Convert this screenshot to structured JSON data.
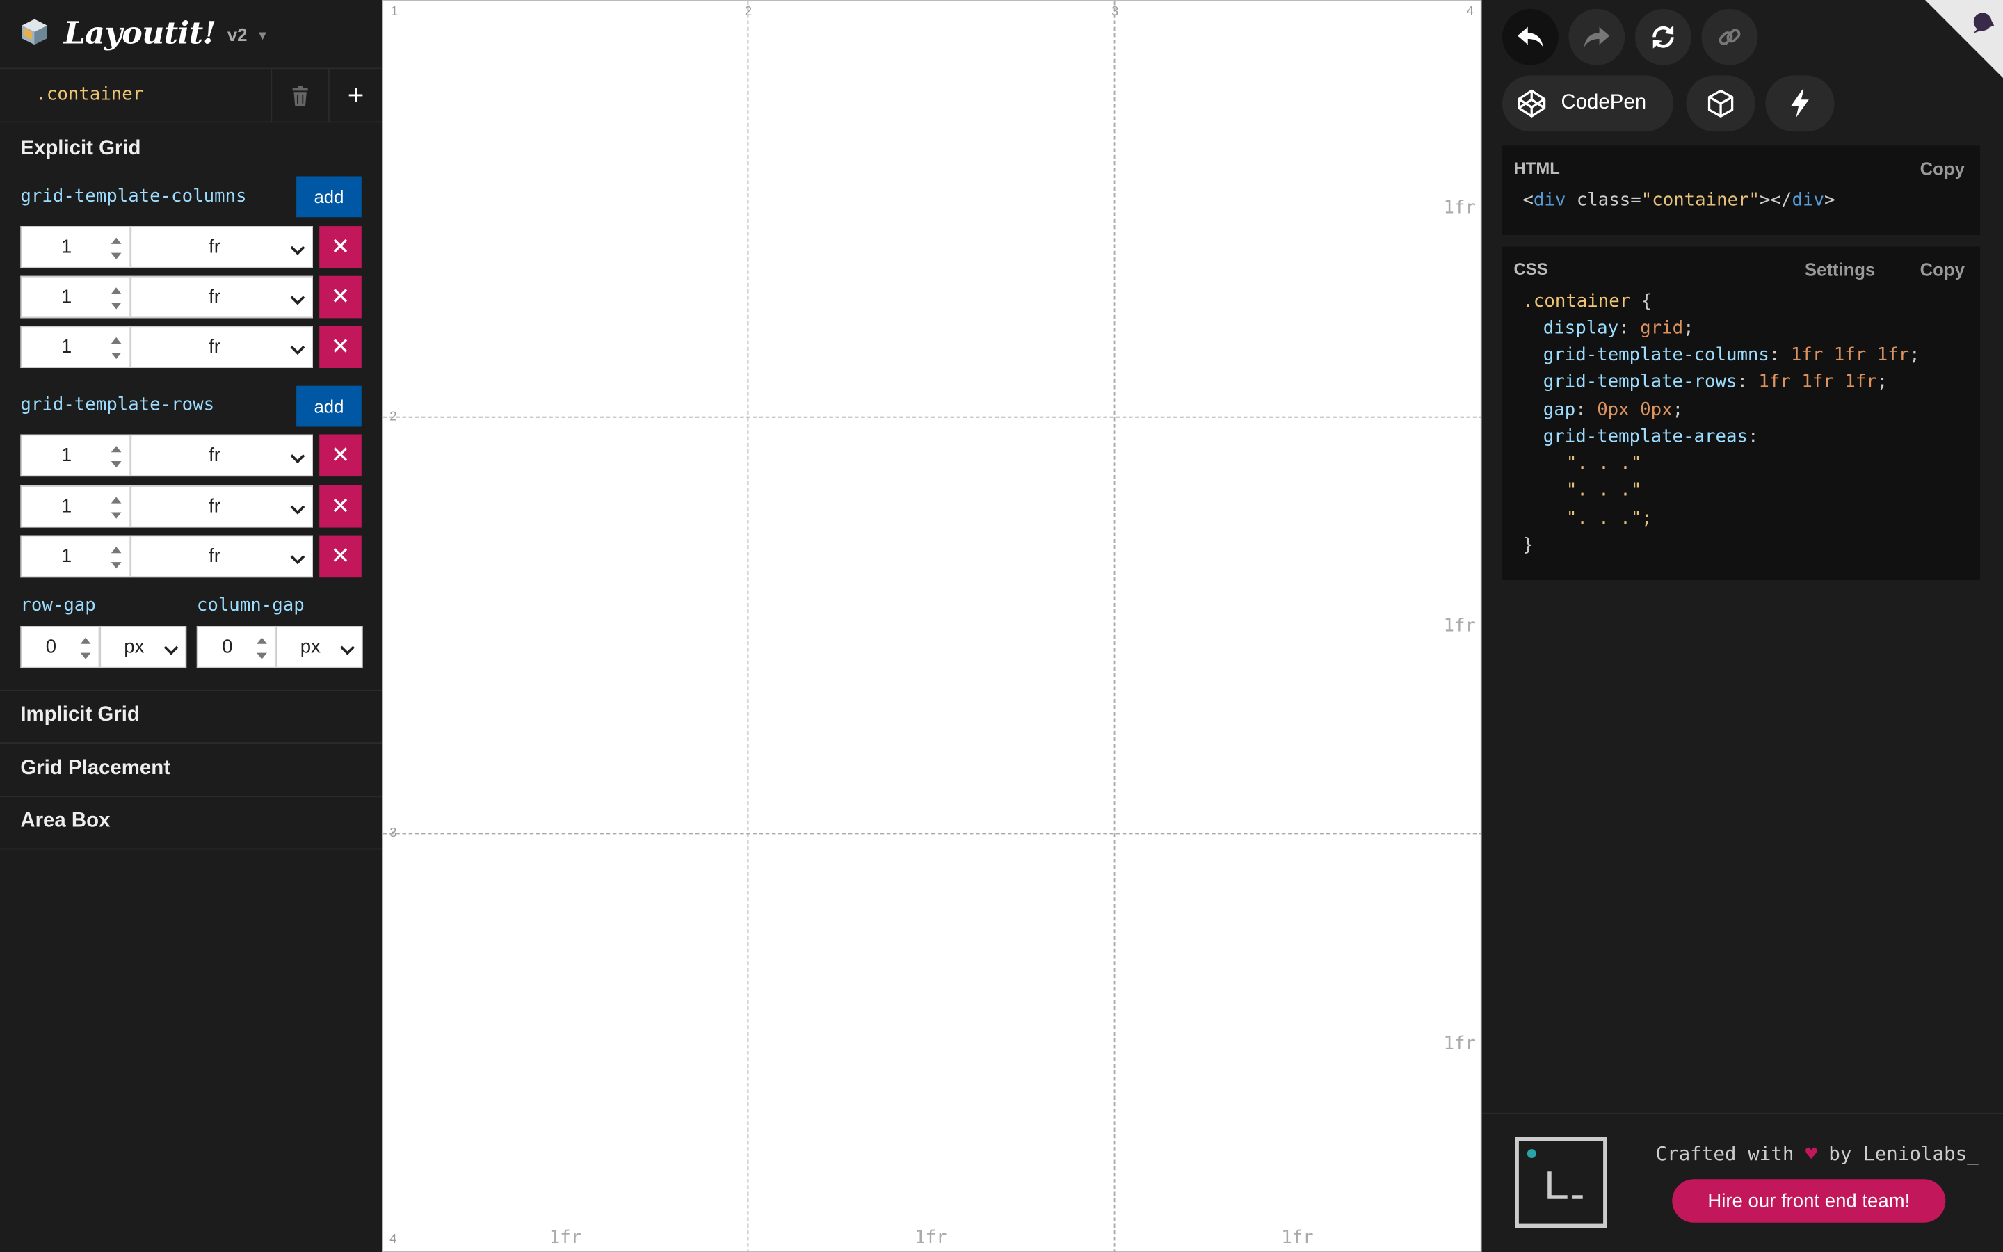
{
  "app": {
    "title": "Layoutit!",
    "version": "v2"
  },
  "container": {
    "name": ".container"
  },
  "explicit_grid": {
    "title": "Explicit Grid",
    "columns": {
      "label": "grid-template-columns",
      "add_label": "add",
      "tracks": [
        {
          "value": "1",
          "unit": "fr"
        },
        {
          "value": "1",
          "unit": "fr"
        },
        {
          "value": "1",
          "unit": "fr"
        }
      ]
    },
    "rows": {
      "label": "grid-template-rows",
      "add_label": "add",
      "tracks": [
        {
          "value": "1",
          "unit": "fr"
        },
        {
          "value": "1",
          "unit": "fr"
        },
        {
          "value": "1",
          "unit": "fr"
        }
      ]
    },
    "row_gap": {
      "label": "row-gap",
      "value": "0",
      "unit": "px"
    },
    "column_gap": {
      "label": "column-gap",
      "value": "0",
      "unit": "px"
    }
  },
  "sections": {
    "implicit": "Implicit Grid",
    "placement": "Grid Placement",
    "area": "Area Box"
  },
  "canvas": {
    "column_lines": [
      "1",
      "2",
      "3",
      "4"
    ],
    "row_lines": [
      "2",
      "3",
      "4"
    ],
    "column_tracks": [
      "1fr",
      "1fr",
      "1fr"
    ],
    "row_tracks": [
      "1fr",
      "1fr",
      "1fr"
    ]
  },
  "toolbar": {
    "codepen_label": "CodePen"
  },
  "html_panel": {
    "title": "HTML",
    "copy_label": "Copy",
    "code": {
      "open": "<",
      "tag": "div",
      "attr": " class=",
      "attr_val": "\"container\"",
      "mid": "></",
      "end": ">"
    }
  },
  "css_panel": {
    "title": "CSS",
    "settings_label": "Settings",
    "copy_label": "Copy",
    "selector": ".container",
    "open_brace": " {",
    "close_brace": "}",
    "props": [
      {
        "name": "display",
        "value": "grid"
      },
      {
        "name": "grid-template-columns",
        "value": "1fr 1fr 1fr"
      },
      {
        "name": "grid-template-rows",
        "value": "1fr 1fr 1fr"
      },
      {
        "name": "gap",
        "value": "0px 0px"
      }
    ],
    "areas_prop": "grid-template-areas",
    "areas": [
      "\". . .\"",
      "\". . .\"",
      "\". . .\";"
    ]
  },
  "footer": {
    "credit_prefix": "Crafted with ",
    "heart": "♥",
    "credit_suffix": " by Leniolabs_",
    "hire_label": "Hire our front end team!",
    "colors": {
      "heart": "#c2185b",
      "hire": "#c2185b",
      "add": "#0057a3"
    }
  }
}
